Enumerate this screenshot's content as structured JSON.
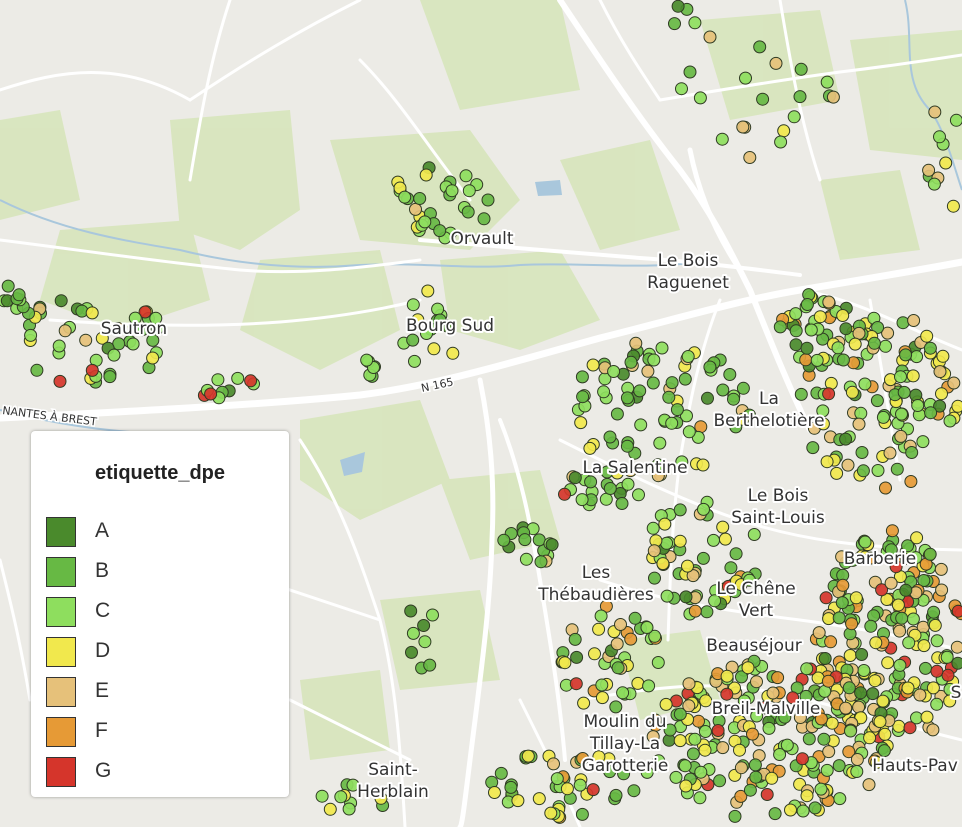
{
  "map": {
    "places": [
      {
        "lines": [
          "Orvault"
        ]
      },
      {
        "lines": [
          "Le Bois",
          "Raguenet"
        ]
      },
      {
        "lines": [
          "Sautron"
        ]
      },
      {
        "lines": [
          "Bourg Sud"
        ]
      },
      {
        "lines": [
          "La",
          "Berthelotière"
        ]
      },
      {
        "lines": [
          "La Salentine"
        ]
      },
      {
        "lines": [
          "Le Bois",
          "Saint-Louis"
        ]
      },
      {
        "lines": [
          "Barberie"
        ]
      },
      {
        "lines": [
          "Les",
          "Thébaudières"
        ]
      },
      {
        "lines": [
          "Le Chêne",
          "Vert"
        ]
      },
      {
        "lines": [
          "Beauséjour"
        ]
      },
      {
        "lines": [
          "Breil-Malville"
        ]
      },
      {
        "lines": [
          "Moulin du",
          "Tillay-La",
          "Garotterie"
        ]
      },
      {
        "lines": [
          "Saint-",
          "Herblain"
        ]
      },
      {
        "lines": [
          "Hauts-Pav"
        ]
      },
      {
        "lines": [
          "S"
        ]
      }
    ],
    "road_labels": [
      "N 165",
      "NANTES À BREST"
    ]
  },
  "legend": {
    "title": "etiquette_dpe",
    "items": [
      {
        "label": "A",
        "color": "#4a8a2c"
      },
      {
        "label": "B",
        "color": "#67b944"
      },
      {
        "label": "C",
        "color": "#8ede5e"
      },
      {
        "label": "D",
        "color": "#f1e84d"
      },
      {
        "label": "E",
        "color": "#e6c17a"
      },
      {
        "label": "F",
        "color": "#e69a36"
      },
      {
        "label": "G",
        "color": "#d5352b"
      }
    ]
  }
}
